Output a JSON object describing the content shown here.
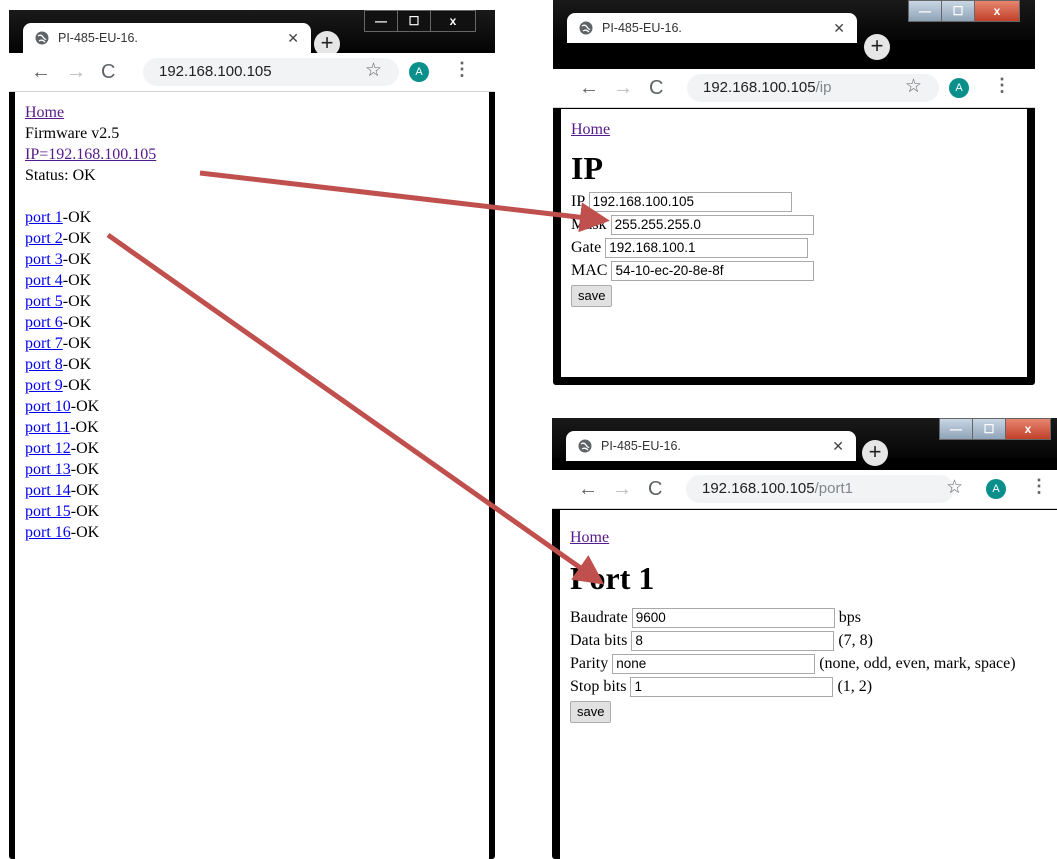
{
  "left_window": {
    "tab_title": "PI-485-EU-16.",
    "url": "192.168.100.105",
    "url_path": "",
    "avatar": "A",
    "home_link": "Home",
    "firmware": "Firmware v2.5",
    "ip_link": "IP=192.168.100.105",
    "status": "Status: OK",
    "ports": [
      {
        "link": "port 1",
        "status": "-OK"
      },
      {
        "link": "port 2",
        "status": "-OK"
      },
      {
        "link": "port 3",
        "status": "-OK"
      },
      {
        "link": "port 4",
        "status": "-OK"
      },
      {
        "link": "port 5",
        "status": "-OK"
      },
      {
        "link": "port 6",
        "status": "-OK"
      },
      {
        "link": "port 7",
        "status": "-OK"
      },
      {
        "link": "port 8",
        "status": "-OK"
      },
      {
        "link": "port 9",
        "status": "-OK"
      },
      {
        "link": "port 10",
        "status": "-OK"
      },
      {
        "link": "port 11",
        "status": "-OK"
      },
      {
        "link": "port 12",
        "status": "-OK"
      },
      {
        "link": "port 13",
        "status": "-OK"
      },
      {
        "link": "port 14",
        "status": "-OK"
      },
      {
        "link": "port 15",
        "status": "-OK"
      },
      {
        "link": "port 16",
        "status": "-OK"
      }
    ]
  },
  "ip_window": {
    "tab_title": "PI-485-EU-16.",
    "url_host": "192.168.100.105",
    "url_path": "/ip",
    "avatar": "A",
    "home_link": "Home",
    "heading": "IP",
    "fields": {
      "ip_label": "IP",
      "ip_value": "192.168.100.105",
      "mask_label": "Mask",
      "mask_value": "255.255.255.0",
      "gate_label": "Gate",
      "gate_value": "192.168.100.1",
      "mac_label": "MAC",
      "mac_value": "54-10-ec-20-8e-8f"
    },
    "save_label": "save"
  },
  "port_window": {
    "tab_title": "PI-485-EU-16.",
    "url_host": "192.168.100.105",
    "url_path": "/port1",
    "avatar": "A",
    "home_link": "Home",
    "heading": "Port 1",
    "fields": {
      "baud_label": "Baudrate",
      "baud_value": "9600",
      "baud_hint": "bps",
      "bits_label": "Data bits",
      "bits_value": "8",
      "bits_hint": "(7, 8)",
      "parity_label": "Parity",
      "parity_value": "none",
      "parity_hint": "(none, odd, even, mark, space)",
      "stop_label": "Stop bits",
      "stop_value": "1",
      "stop_hint": "(1, 2)"
    },
    "save_label": "save"
  },
  "colors": {
    "arrow": "#c0504d",
    "link": "#0000ee",
    "visited_link": "#551a8b",
    "avatar": "#0a8f8b"
  }
}
